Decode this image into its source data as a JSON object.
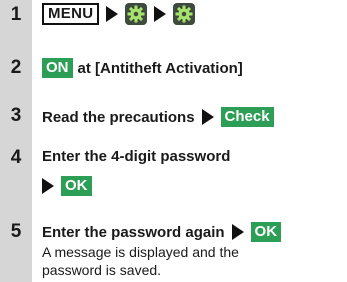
{
  "steps": [
    {
      "number": "1",
      "menu_key": "MENU",
      "icons": [
        "settings-gear-icon",
        "settings-gear-icon"
      ]
    },
    {
      "number": "2",
      "button": "ON",
      "text": "at [Antitheft Activation]"
    },
    {
      "number": "3",
      "text": "Read the precautions",
      "button": "Check"
    },
    {
      "number": "4",
      "text": "Enter the 4-digit password",
      "button": "OK"
    },
    {
      "number": "5",
      "text": "Enter the password again",
      "button": "OK",
      "note_line1": "A message is displayed and the",
      "note_line2": "password is saved."
    }
  ],
  "colors": {
    "button_green": "#2d9e56",
    "number_column": "#d6d6d6"
  }
}
